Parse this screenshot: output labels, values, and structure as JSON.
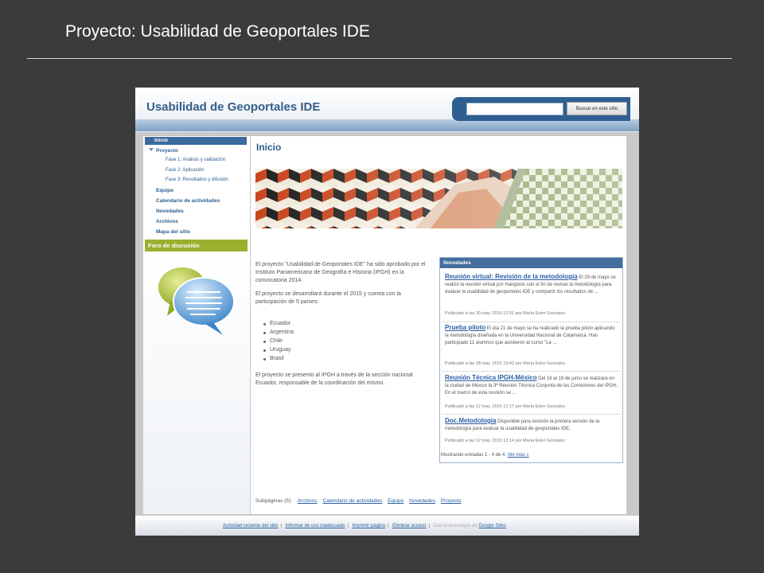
{
  "slide": {
    "title": "Proyecto: Usabilidad de Geoportales IDE"
  },
  "site": {
    "title": "Usabilidad de Geoportales IDE",
    "search_button": "Buscar en este sitio"
  },
  "sidebar": {
    "items": [
      "Inicio",
      "Proyecto",
      "Fase 1: Análisis y validación",
      "Fase 2: Aplicación",
      "Fase 3: Resultados y difusión",
      "Equipo",
      "Calendario de actividades",
      "Novedades",
      "Archivos",
      "Mapa del sitio"
    ],
    "forum": "Foro de discusión"
  },
  "main": {
    "title": "Inicio",
    "intro": [
      "El proyecto \"Usabilidad de Geoportales IDE\" ha sido aprobado por el Instituto Panamericano de Geografía e Historia (IPGH) en la convocatoria 2014.",
      "El proyecto se desarrollará durante el 2015 y cuenta con la participación de 5 países:"
    ],
    "countries": [
      "Ecuador",
      "Argentina",
      "Chile",
      "Uruguay",
      "Brasil"
    ],
    "closing": "El proyecto se presento al IPGH a través de la sección nacional Ecuador, responsable de la coordinación del mismo."
  },
  "news": {
    "header": "Novedades",
    "items": [
      {
        "title": "Reunión virtual: Revisión de la metodología",
        "body": "El 29 de mayo se realizó la reunión virtual por Hangouts con el fin de revisar la metodología para evaluar la usabilidad de geoportales IDE y compartir los resultados de ...",
        "meta": "Publicado a las 30 may. 2015 12:51 por María Ester Gonzalez"
      },
      {
        "title": "Prueba piloto",
        "body": "El día 21 de mayo se ha realizado la prueba piloto aplicando la metodología diseñada en la Universidad Nacional de Catamarca. Han participado 11 alumnos que asistieron al curso \"La ...",
        "meta": "Publicado a las 28 may. 2015 19:42 por María Ester Gonzalez"
      },
      {
        "title": "Reunión Técnica IPGH-México",
        "body": "Del 16 al 19 de junio se realizará en la ciudad de México la 3ª Reunión Técnica Conjunta de las Comisiones del IPGH. En el marco de esta reunión se ...",
        "meta": "Publicado a las 12 may. 2015 12:17 por María Ester Gonzalez"
      },
      {
        "title": "Doc.Metodología",
        "body": "Disponible para revisión la primera versión de la metodología para evaluar la usabilidad de geoportales IDE.",
        "meta": "Publicado a las 12 may. 2015 12:14 por María Ester Gonzalez"
      }
    ],
    "footer_text": "Mostrando entradas 1 - 4 de 4.",
    "footer_link": "Ver más »"
  },
  "subpages": {
    "label": "Subpáginas (5):",
    "links": [
      "Archivos",
      "Calendario de actividades",
      "Equipo",
      "Novedades",
      "Proyecto"
    ]
  },
  "footer": {
    "links": [
      "Actividad reciente del sitio",
      "Informar de uso inadecuado",
      "Imprimir página",
      "Eliminar acceso"
    ],
    "tech_text": "Con la tecnología de",
    "tech_link": "Google Sites"
  }
}
